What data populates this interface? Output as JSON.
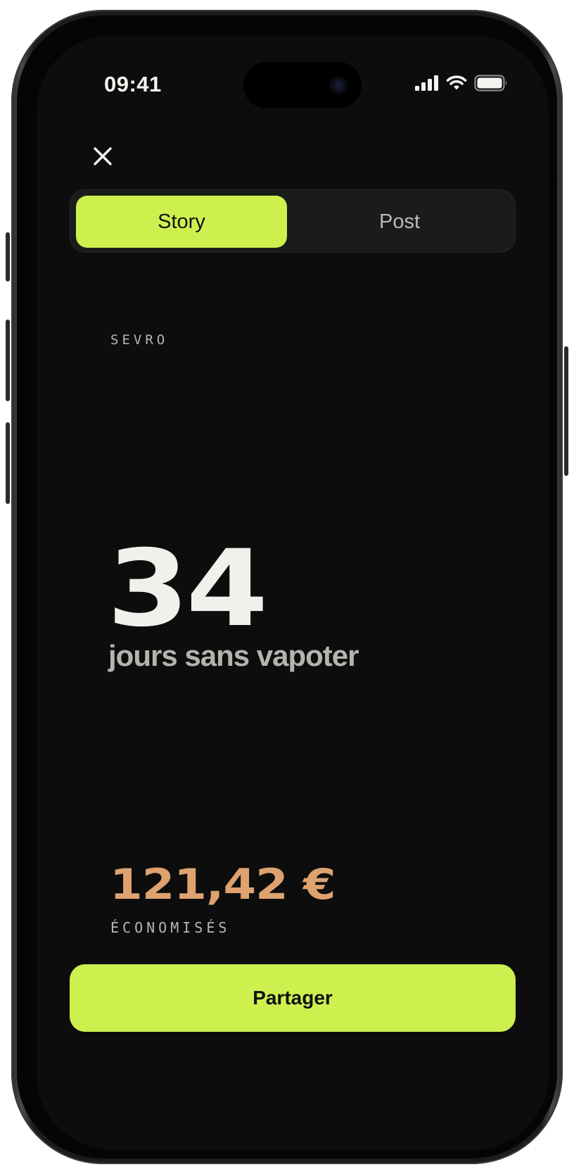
{
  "status_bar": {
    "time": "09:41"
  },
  "header": {
    "close_icon": "close-icon"
  },
  "tabs": [
    {
      "label": "Story",
      "selected": true
    },
    {
      "label": "Post",
      "selected": false
    }
  ],
  "card": {
    "brand": "SEVRO",
    "days_count": "34",
    "days_label": "jours sans vapoter",
    "savings_amount": "121,42 €",
    "savings_label": "ÉCONOMISÉS"
  },
  "actions": {
    "share_label": "Partager"
  },
  "colors": {
    "accent": "#cdf04e",
    "background": "#0c0d0c",
    "savings": "#dea26f"
  }
}
